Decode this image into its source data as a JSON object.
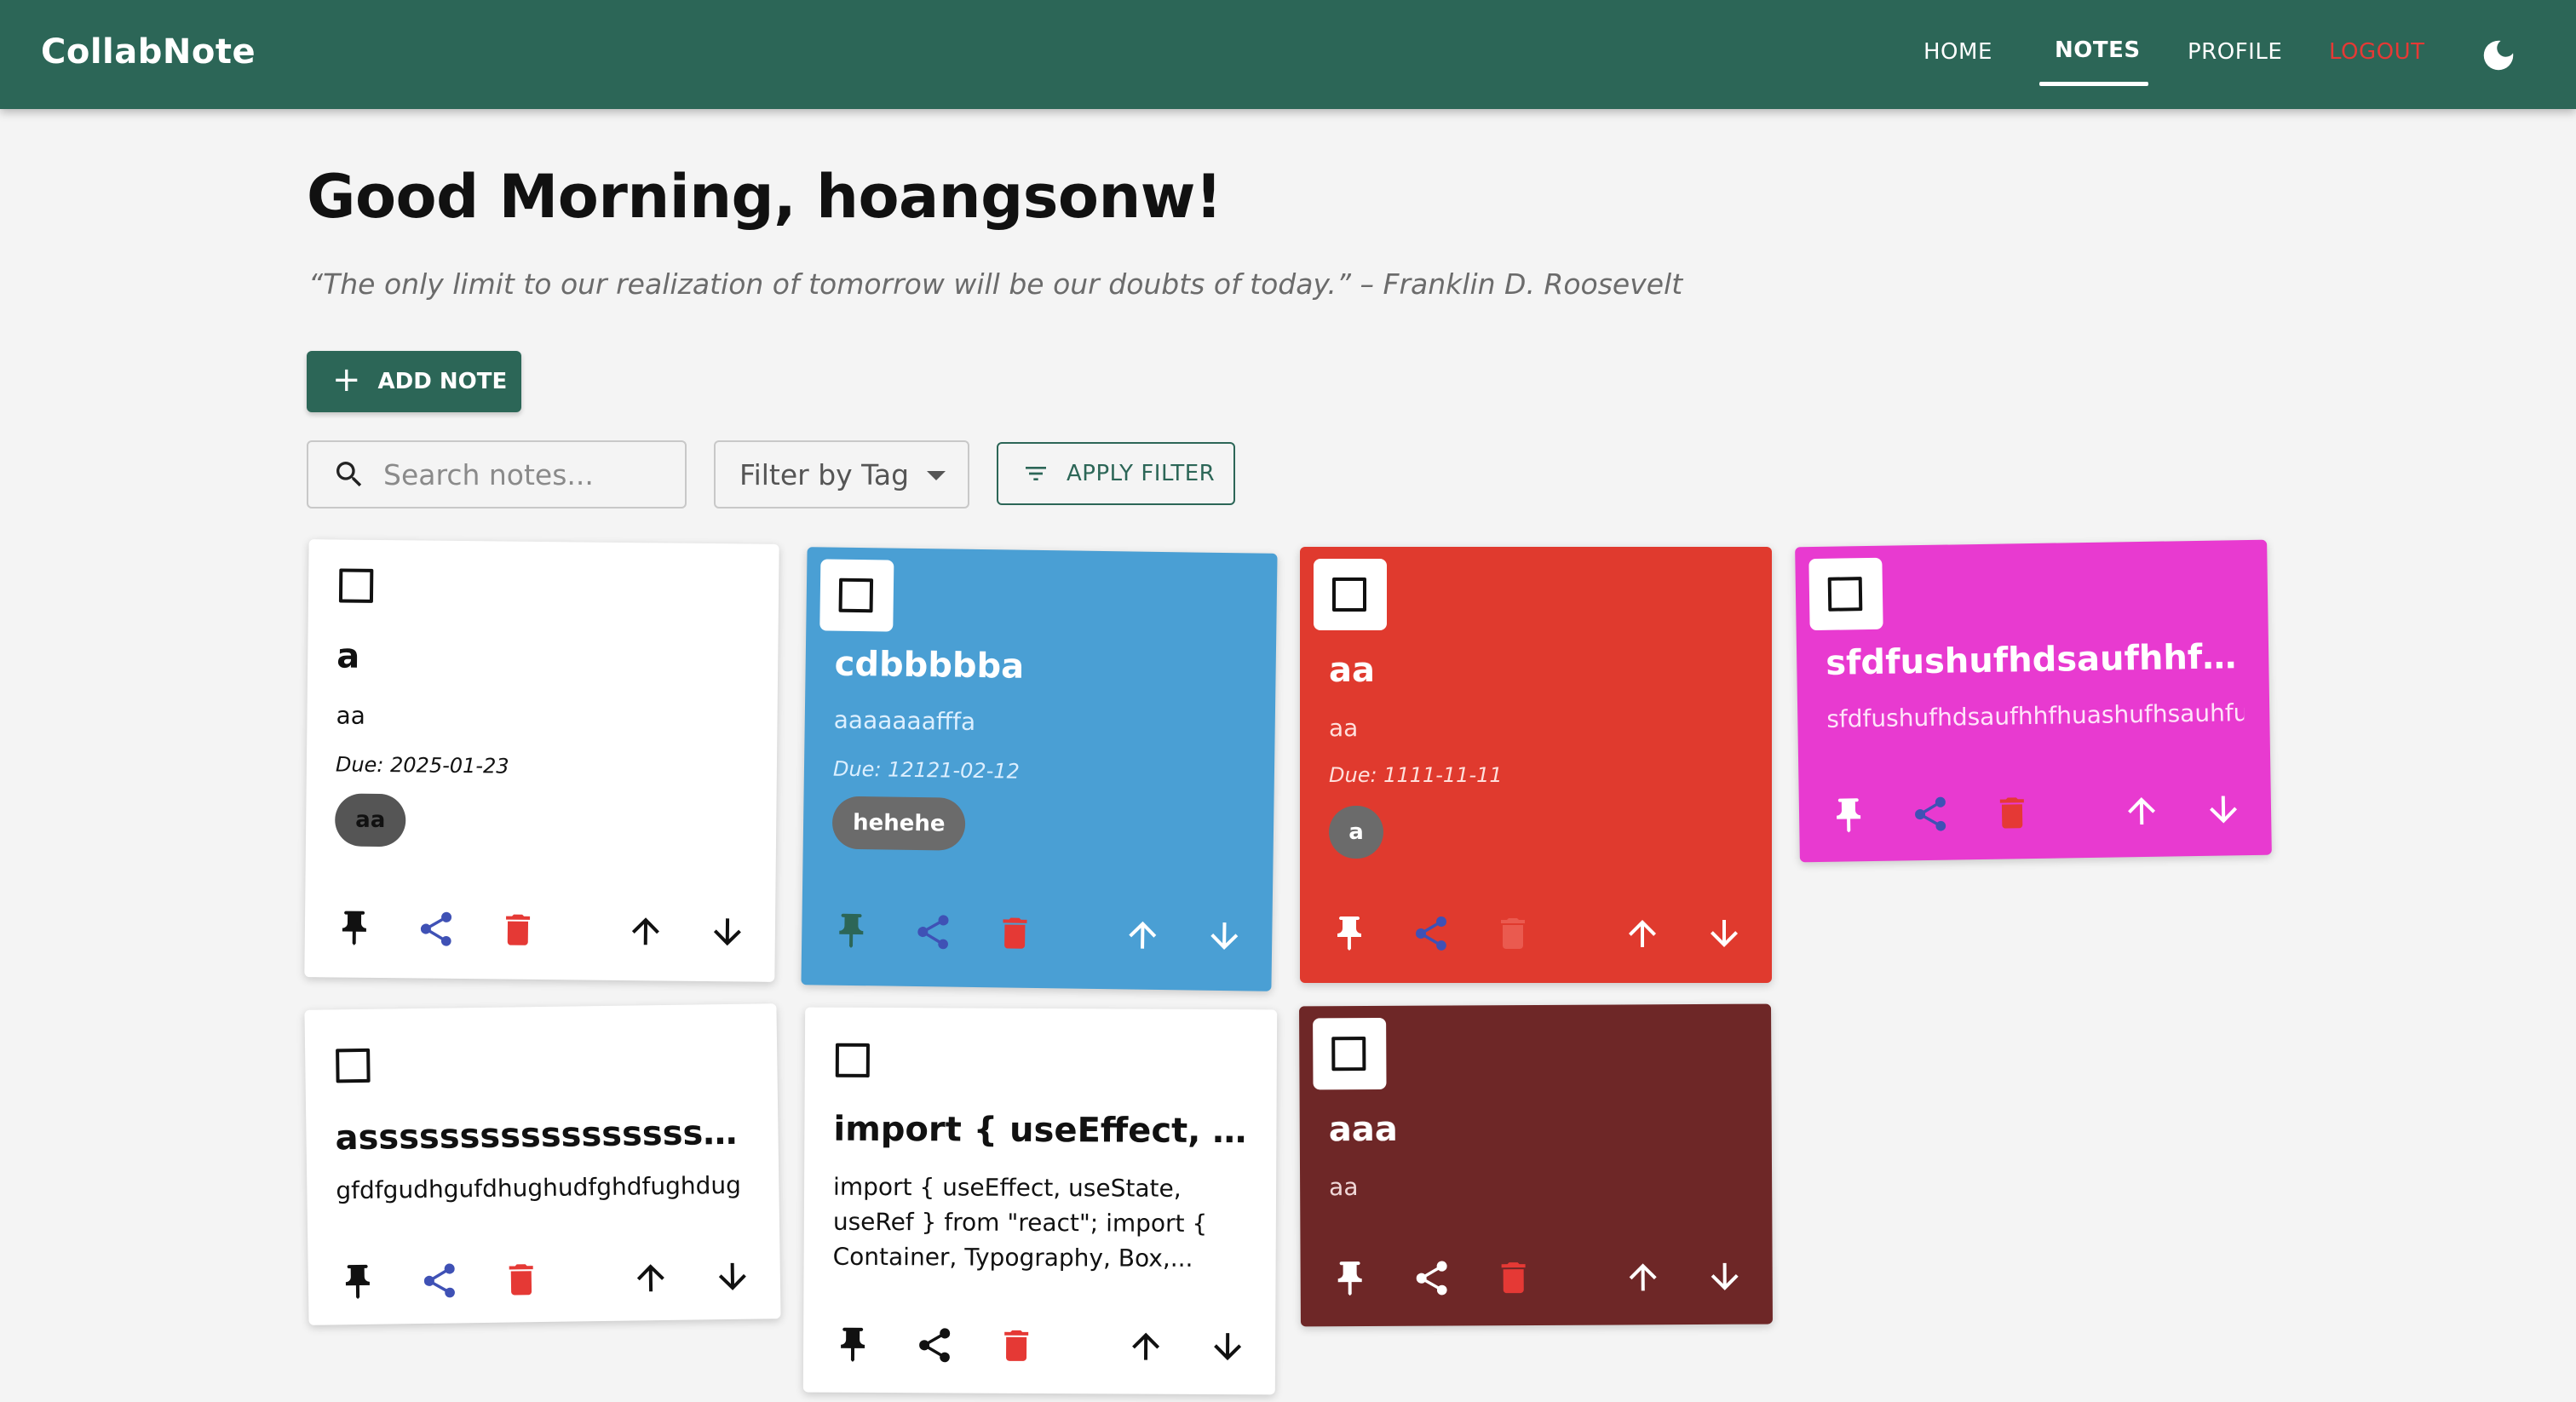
{
  "app": {
    "title": "CollabNote"
  },
  "nav": {
    "home": "HOME",
    "notes": "NOTES",
    "profile": "PROFILE",
    "logout": "LOGOUT",
    "theme_icon": "moon-icon"
  },
  "greeting": "Good Morning, hoangsonw!",
  "quote": "“The only limit to our realization of tomorrow will be our doubts of today.” – Franklin D. Roosevelt",
  "toolbar": {
    "add_label": "ADD NOTE",
    "search_placeholder": "Search notes...",
    "filter_label": "Filter by Tag",
    "apply_label": "APPLY FILTER"
  },
  "colors": {
    "primary": "#2c6657",
    "share": "#3f51b5",
    "delete": "#e53935"
  },
  "notes": [
    {
      "title": "a",
      "content": "aa",
      "due": "Due: 2025-01-23",
      "tag": "aa",
      "color": "#ffffff",
      "text_color": "#111111"
    },
    {
      "title": "cdbbbbba",
      "content": "aaaaaaafffa",
      "due": "Due: 12121-02-12",
      "tag": "hehehe",
      "color": "#4a9fd4",
      "text_color": "#ffffff"
    },
    {
      "title": "aa",
      "content": "aa",
      "due": "Due: 1111-11-11",
      "tag": "a",
      "color": "#e03a2e",
      "text_color": "#ffffff"
    },
    {
      "title": "sfdfushufhdsaufhhfhu...",
      "content": "sfdfushufhdsaufhhfhuashufhsauhfu",
      "color": "#e83ad0",
      "text_color": "#ffffff"
    },
    {
      "title": "asssssssssssssssssss...",
      "content": "gfdfgudhgufdhughudfghdfughdug",
      "color": "#ffffff",
      "text_color": "#111111"
    },
    {
      "title": "import { useEffect, use...",
      "content": "import { useEffect, useState, useRef } from \"react\"; import { Container, Typography, Box,...",
      "color": "#ffffff",
      "text_color": "#111111"
    },
    {
      "title": "aaa",
      "content": "aa",
      "color": "#6e2727",
      "text_color": "#ffffff"
    }
  ]
}
